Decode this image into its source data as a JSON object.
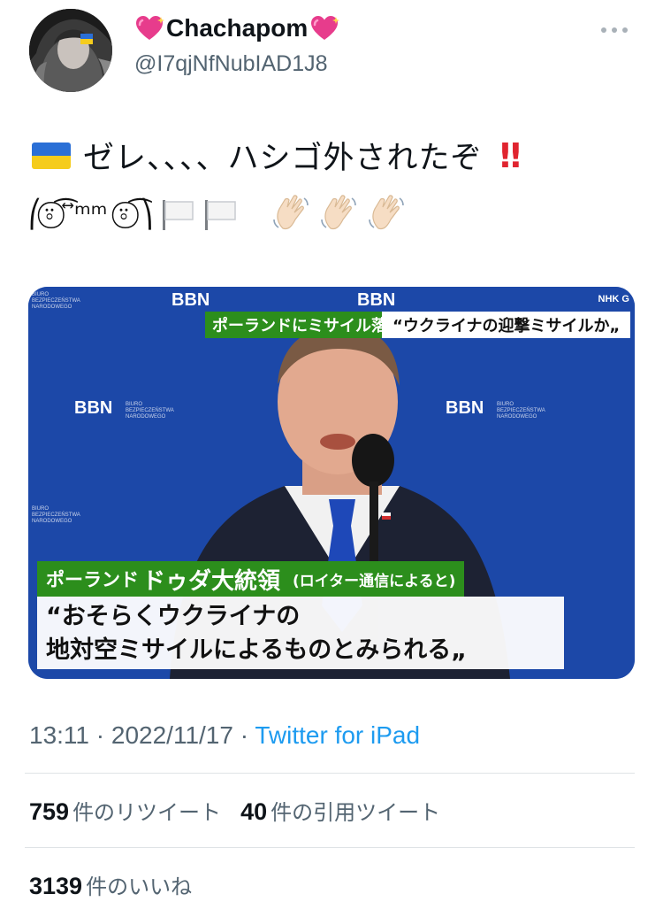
{
  "profile": {
    "display_name": "Chachapom",
    "handle": "@I7qjNfNubIAD1J8"
  },
  "tweet": {
    "line1_text": "ゼレ、、、、ハシゴ外されたぞ",
    "line1_emphasis": "‼",
    "line2_kaomoji": "⎛⍤⃝ ͡ ⃡ᵐᵐ ⍤⃝ ͡⎞"
  },
  "media": {
    "top_caption_green": "ポーランドにミサイル落下",
    "top_caption_white": "“ウクライナの迎撃ミサイルか„",
    "broadcaster": "NHK G",
    "logo_text": "BBN",
    "logo_subtext": "BIURO BEZPIECZEŃSTWA NARODOWEGO",
    "speaker_prefix": "ポーランド",
    "speaker_name": "ドゥダ大統領",
    "speaker_source": "(ロイター通信によると)",
    "quote_line1": "“おそらくウクライナの",
    "quote_line2": "地対空ミサイルによるものとみられる„"
  },
  "meta": {
    "time": "13:11",
    "separator": "·",
    "date": "2022/11/17",
    "source": "Twitter for iPad"
  },
  "stats": {
    "retweets": "759",
    "retweets_label": "件のリツイート",
    "quotes": "40",
    "quotes_label": "件の引用ツイート",
    "likes": "3139",
    "likes_label": "件のいいね"
  },
  "colors": {
    "link": "#1d9bf0",
    "secondary_text": "#536471",
    "caption_green": "#2c8e1c",
    "backdrop_blue": "#1d49a8",
    "flag_blue": "#2a6fd6",
    "flag_yellow": "#f5cc1c"
  },
  "icons": [
    "avatar",
    "sparkling-heart-icon",
    "more-icon",
    "ukraine-flag-icon",
    "double-exclamation-icon",
    "white-flag-icon",
    "waving-hand-icon"
  ]
}
